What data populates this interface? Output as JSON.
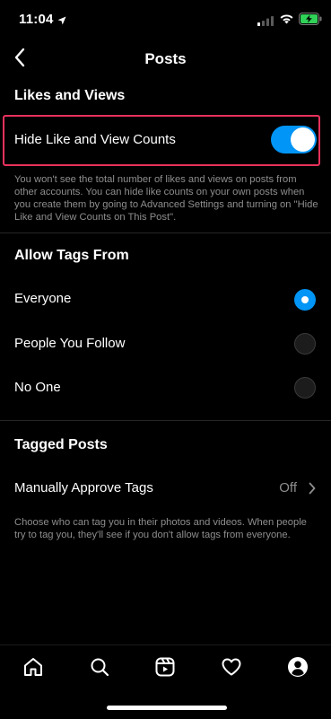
{
  "status_bar": {
    "time": "11:04"
  },
  "header": {
    "title": "Posts"
  },
  "likes_views": {
    "heading": "Likes and Views",
    "toggle_label": "Hide Like and View Counts",
    "toggle_on": true,
    "description": "You won't see the total number of likes and views on posts from other accounts. You can hide like counts on your own posts when you create them by going to Advanced Settings and turning on \"Hide Like and View Counts on This Post\"."
  },
  "allow_tags": {
    "heading": "Allow Tags From",
    "options": [
      {
        "label": "Everyone",
        "selected": true
      },
      {
        "label": "People You Follow",
        "selected": false
      },
      {
        "label": "No One",
        "selected": false
      }
    ]
  },
  "tagged_posts": {
    "heading": "Tagged Posts",
    "manual_label": "Manually Approve Tags",
    "manual_value": "Off",
    "description": "Choose who can tag you in their photos and videos. When people try to tag you, they'll see if you don't allow tags from everyone."
  },
  "tab_bar": {
    "tabs": [
      "home-icon",
      "search-icon",
      "reels-icon",
      "heart-icon",
      "profile-icon"
    ]
  },
  "colors": {
    "accent": "#0095f6",
    "highlight": "#e8315c",
    "secondary_text": "#8e8e8e",
    "background": "#000000"
  }
}
